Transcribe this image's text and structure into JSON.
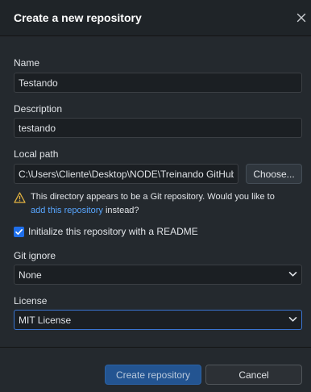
{
  "dialog": {
    "title": "Create a new repository",
    "close_icon": "close-icon"
  },
  "form": {
    "name_label": "Name",
    "name_value": "Testando",
    "description_label": "Description",
    "description_value": "testando",
    "local_path_label": "Local path",
    "local_path_value": "C:\\Users\\Cliente\\Desktop\\NODE\\Treinando GitHub",
    "choose_button": "Choose...",
    "warning_icon": "warning-icon",
    "warning_text": "This directory appears to be a Git repository. Would you like to",
    "warning_link": "add this repository",
    "warning_suffix": "instead?",
    "readme_checked": true,
    "readme_label": "Initialize this repository with a README",
    "gitignore_label": "Git ignore",
    "gitignore_value": "None",
    "license_label": "License",
    "license_value": "MIT License"
  },
  "footer": {
    "create_button": "Create repository",
    "cancel_button": "Cancel"
  },
  "colors": {
    "background": "#24292e",
    "header": "#1f2428",
    "input_bg": "#1b1f23",
    "accent": "#1f6feb",
    "link": "#58a6ff",
    "warning": "#e3b341",
    "primary_button": "#235491"
  }
}
